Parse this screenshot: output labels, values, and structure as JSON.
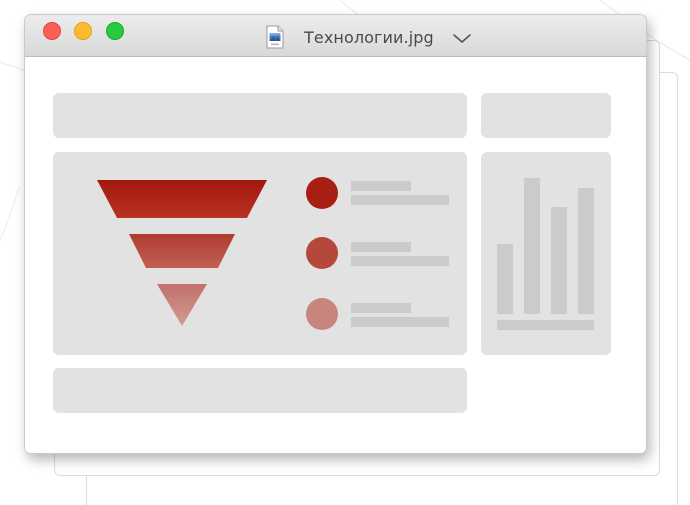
{
  "window": {
    "title": "Технологии.jpg",
    "file_icon": "image-file-icon",
    "title_dropdown_icon": "chevron-down-icon"
  },
  "traffic_lights": {
    "close_color": "#fc5f57",
    "minimize_color": "#fdbc2e",
    "maximize_color": "#29c941"
  },
  "preview": {
    "funnel_colors": [
      "#a81e12",
      "#b5473b",
      "#c7857e"
    ],
    "legend_dot_colors": [
      "#a81e12",
      "#b5473b",
      "#c7857e"
    ],
    "placeholder_color": "#e2e2e2",
    "placeholder_bar_color": "#cbcbcb"
  }
}
